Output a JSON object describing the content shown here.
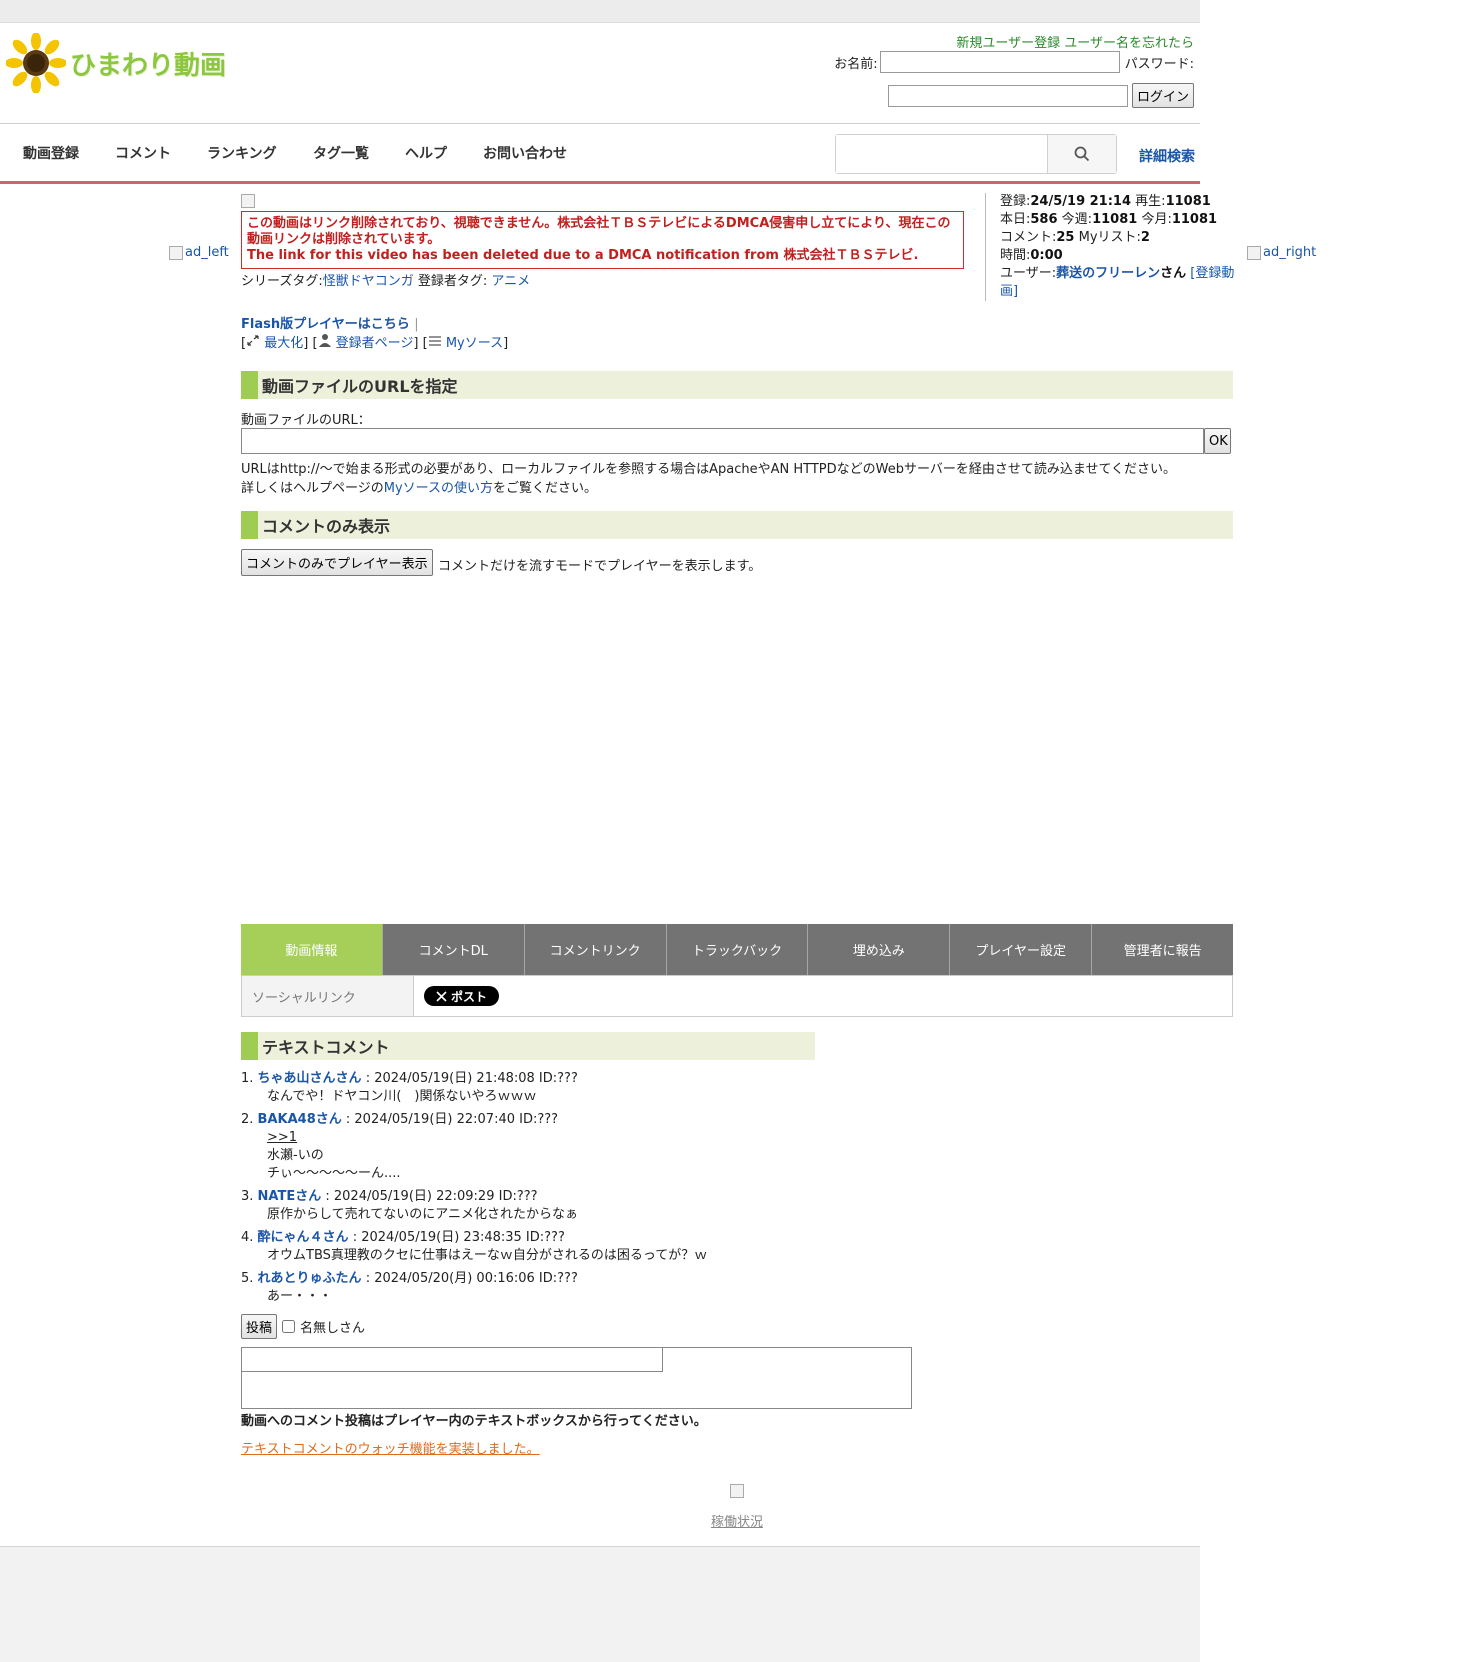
{
  "site": {
    "logo_text": "ひまわり動画"
  },
  "auth": {
    "register": "新規ユーザー登録",
    "forgot": "ユーザー名を忘れたら",
    "name_label": "お名前:",
    "password_label": "パスワード:",
    "login_button": "ログイン"
  },
  "nav": {
    "items": [
      "動画登録",
      "コメント",
      "ランキング",
      "タグ一覧",
      "ヘルプ",
      "お問い合わせ"
    ],
    "advanced_search": "詳細検索"
  },
  "ads": {
    "left": "ad_left",
    "right": "ad_right"
  },
  "notice": {
    "line1": "この動画はリンク削除されており、視聴できません。株式会社ＴＢＳテレビによるDMCA侵害申し立てにより、現在この動画リンクは削除されています。",
    "line2": "The link for this video has been deleted due to a DMCA notification from 株式会社ＴＢＳテレビ."
  },
  "tags": {
    "series_label": "シリーズタグ:",
    "series_tag": "怪獣ドヤコンガ",
    "owner_label": "登録者タグ:",
    "owner_tag": "アニメ"
  },
  "info": {
    "reg_label": "登録:",
    "reg_value": "24/5/19 21:14",
    "play_label": "再生:",
    "play_value": "11081",
    "today_label": "本日:",
    "today_value": "586",
    "week_label": "今週:",
    "week_value": "11081",
    "month_label": "今月:",
    "month_value": "11081",
    "comment_label": "コメント:",
    "comment_value": "25",
    "mylist_label": "Myリスト:",
    "mylist_value": "2",
    "time_label": "時間:",
    "time_value": "0:00",
    "user_label": "ユーザー:",
    "user_name": "葬送のフリーレン",
    "user_suffix": "さん",
    "user_videos": "[登録動画]"
  },
  "player": {
    "flash_link": "Flash版プレイヤーはこちら",
    "separator": "|",
    "maximize": "最大化",
    "owner_page": "登録者ページ",
    "mysource": "Myソース"
  },
  "url_section": {
    "heading": "動画ファイルのURLを指定",
    "label": "動画ファイルのURL：",
    "ok": "OK",
    "note1": "URLはhttp://〜で始まる形式の必要があり、ローカルファイルを参照する場合はApacheやAN HTTPDなどのWebサーバーを経由させて読み込ませてください。",
    "note2_pre": "詳しくはヘルプページの",
    "note2_link": "Myソースの使い方",
    "note2_post": "をご覧ください。"
  },
  "comment_only": {
    "heading": "コメントのみ表示",
    "button": "コメントのみでプレイヤー表示",
    "note": "コメントだけを流すモードでプレイヤーを表示します。"
  },
  "tabs": [
    "動画情報",
    "コメントDL",
    "コメントリンク",
    "トラックバック",
    "埋め込み",
    "プレイヤー設定",
    "管理者に報告"
  ],
  "social": {
    "label": "ソーシャルリンク",
    "post": "ポスト"
  },
  "text_comments": {
    "heading": "テキストコメント",
    "items": [
      {
        "num": "1.",
        "name": "ちゃあ山さんさん",
        "meta": ": 2024/05/19(日) 21:48:08 ID:???",
        "lines": [
          "なんでや！ドヤコン川(　)関係ないやろｗｗｗ"
        ]
      },
      {
        "num": "2.",
        "name": "BAKA48さん",
        "meta": ": 2024/05/19(日) 22:07:40 ID:???",
        "reply": ">>1",
        "lines": [
          "水瀬-いの",
          "チぃ〜〜〜〜〜ーん...."
        ]
      },
      {
        "num": "3.",
        "name": "NATEさん",
        "meta": ": 2024/05/19(日) 22:09:29 ID:???",
        "lines": [
          "原作からして売れてないのにアニメ化されたからなぁ"
        ]
      },
      {
        "num": "4.",
        "name": "酔にゃん４さん",
        "meta": ": 2024/05/19(日) 23:48:35 ID:???",
        "lines": [
          "オウムTBS真理教のクセに仕事はえーなｗ自分がされるのは困るってが？ｗ"
        ]
      },
      {
        "num": "5.",
        "name": "れあとりゅふたん",
        "meta": ": 2024/05/20(月) 00:16:06 ID:???",
        "lines": [
          "あー・・・"
        ]
      }
    ],
    "post_button": "投稿",
    "anon_label": "名無しさん",
    "post_note": "動画へのコメント投稿はプレイヤー内のテキストボックスから行ってください。",
    "watch_link": "テキストコメントのウォッチ機能を実装しました。"
  },
  "footer": {
    "status": "稼働状況"
  },
  "colors": {
    "accent_green": "#9fcd54",
    "nav_border": "#d7606e",
    "link": "#1a55a8",
    "alert": "#c21f1f"
  }
}
